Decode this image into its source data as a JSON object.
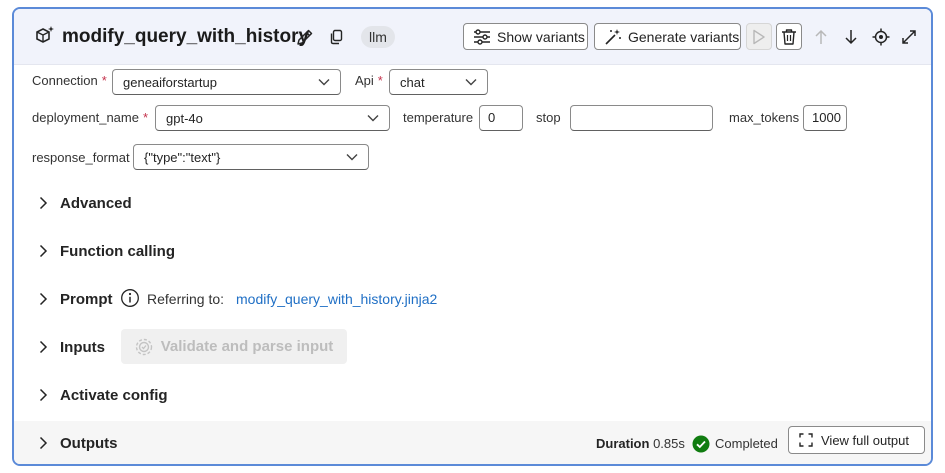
{
  "node": {
    "title": "modify_query_with_history",
    "type_pill": "llm",
    "show_variants_label": "Show variants",
    "generate_variants_label": "Generate variants"
  },
  "form": {
    "connection_label": "Connection",
    "connection_value": "geneaiforstartup",
    "api_label": "Api",
    "api_value": "chat",
    "deployment_label": "deployment_name",
    "deployment_value": "gpt-4o",
    "temperature_label": "temperature",
    "temperature_value": "0",
    "stop_label": "stop",
    "stop_value": "",
    "max_tokens_label": "max_tokens",
    "max_tokens_value": "1000",
    "response_format_label": "response_format",
    "response_format_value": "{\"type\":\"text\"}",
    "required_mark": "*"
  },
  "sections": {
    "advanced": "Advanced",
    "function_calling": "Function calling",
    "prompt": "Prompt",
    "prompt_ref_label": "Referring to:",
    "prompt_ref_link": "modify_query_with_history.jinja2",
    "inputs": "Inputs",
    "validate_label": "Validate and parse input",
    "activate_config": "Activate config",
    "outputs": "Outputs"
  },
  "outputs": {
    "duration_label": "Duration",
    "duration_value": "0.85s",
    "status": "Completed",
    "view_full_output": "View full output"
  },
  "colors": {
    "border_accent": "#5b8ad8",
    "link": "#1f6fc5",
    "success": "#107c10",
    "required": "#c4314b"
  }
}
